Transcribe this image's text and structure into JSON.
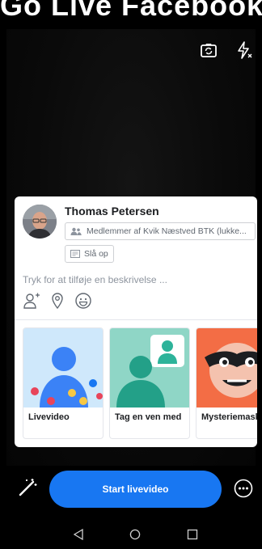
{
  "status_bar": {
    "text": "Go Live Facebook"
  },
  "camera": {
    "switch_icon": "camera-switch-icon",
    "flash_icon": "flash-off-icon"
  },
  "composer": {
    "user_name": "Thomas Petersen",
    "audience_label": "Medlemmer af Kvik Næstved BTK (lukke...",
    "album_label": "Slå op",
    "description_placeholder": "Tryk for at tilføje en beskrivelse ...",
    "actions": [
      "tag-people-icon",
      "location-pin-icon",
      "feeling-smiley-icon"
    ]
  },
  "formats": [
    {
      "label": "Livevideo"
    },
    {
      "label": "Tag en ven med"
    },
    {
      "label": "Mysteriemaske"
    }
  ],
  "bottom": {
    "start_label": "Start livevideo",
    "effects_icon": "magic-wand-icon",
    "more_icon": "more-options-icon"
  },
  "navigation": [
    "back-icon",
    "home-icon",
    "recents-icon"
  ],
  "colors": {
    "accent": "#1877f2",
    "card_bg": "#ffffff",
    "background": "#000000"
  }
}
